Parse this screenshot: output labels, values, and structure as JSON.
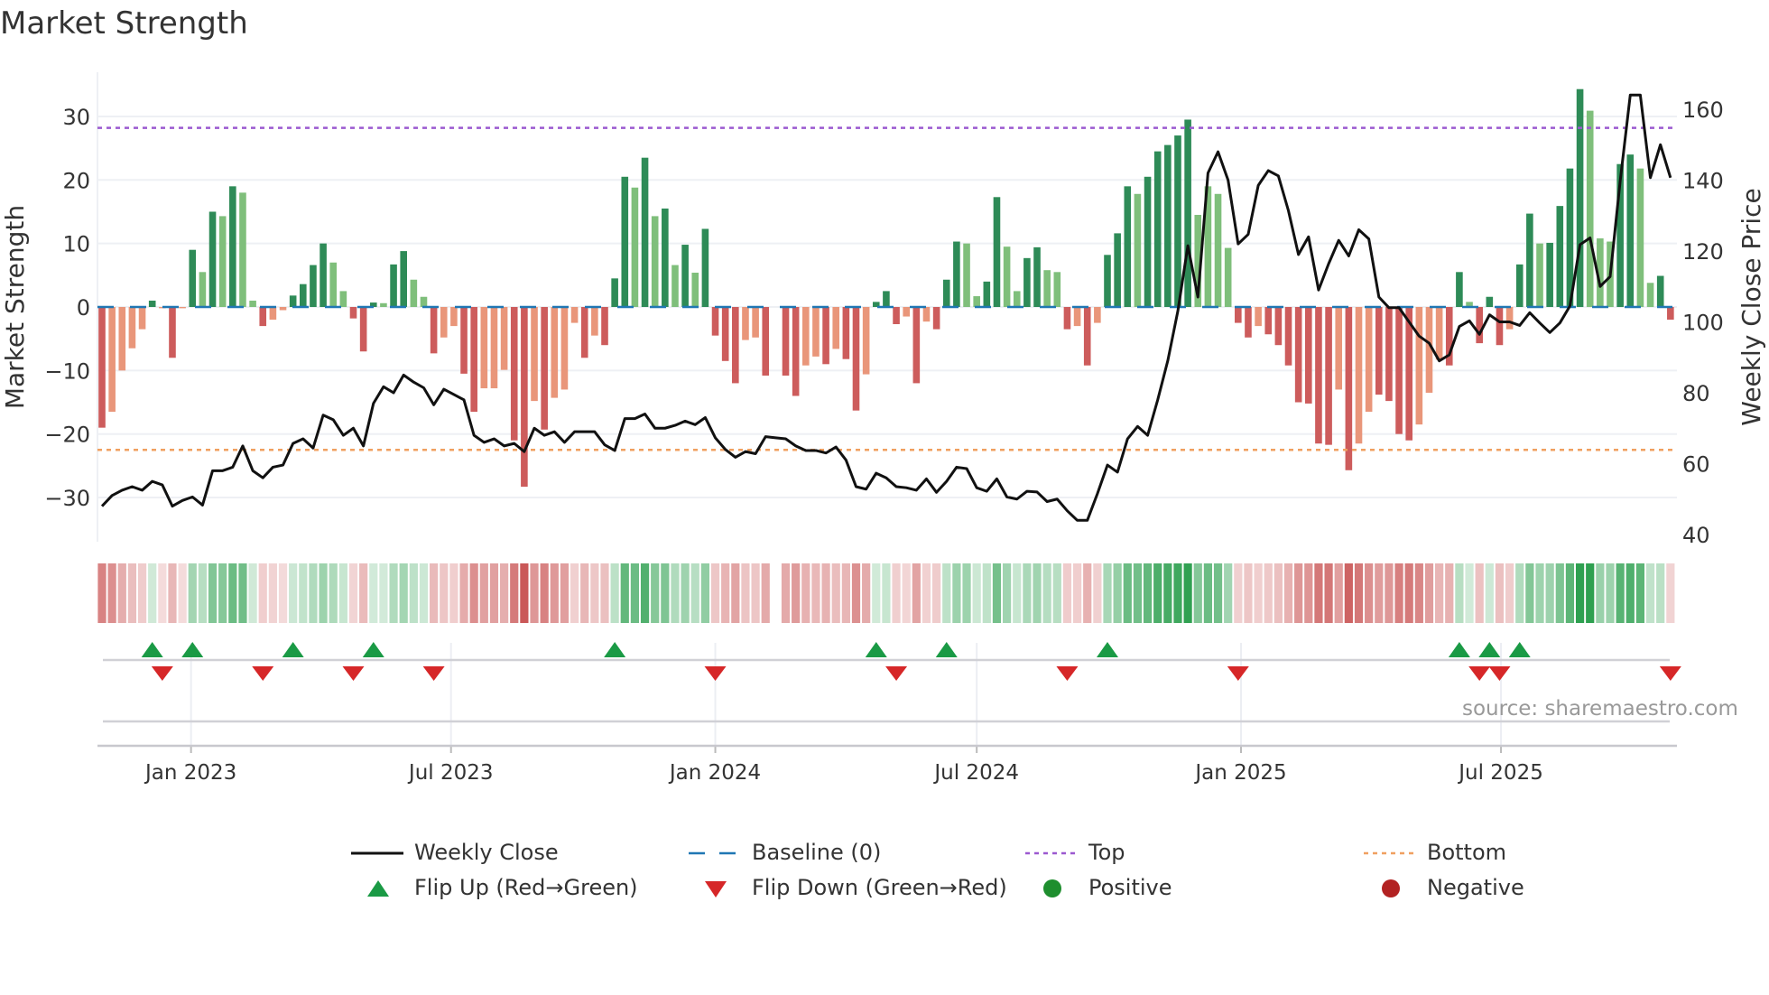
{
  "title": "Market Strength",
  "source": "source: sharemaestro.com",
  "chart_data": {
    "type": "bar",
    "title": "Market Strength",
    "x_start": "2022-10-31",
    "x_interval_days": 7,
    "ylabel": "Market Strength",
    "y2label": "Weekly Close Price",
    "ylim": [
      -35,
      37
    ],
    "y2lim": [
      38,
      172
    ],
    "yticks": [
      "−30",
      "−20",
      "−10",
      "0",
      "10",
      "20",
      "30"
    ],
    "ytick_values": [
      -30,
      -20,
      -10,
      0,
      10,
      20,
      30
    ],
    "y2ticks": [
      "40",
      "60",
      "80",
      "100",
      "120",
      "140",
      "160"
    ],
    "y2tick_values": [
      40,
      60,
      80,
      100,
      120,
      140,
      160
    ],
    "xticks": [
      {
        "label": "Jan 2023",
        "date": "2023-01-01"
      },
      {
        "label": "Jul 2023",
        "date": "2023-07-01"
      },
      {
        "label": "Jan 2024",
        "date": "2024-01-01"
      },
      {
        "label": "Jul 2024",
        "date": "2024-07-01"
      },
      {
        "label": "Jan 2025",
        "date": "2025-01-01"
      },
      {
        "label": "Jul 2025",
        "date": "2025-07-01"
      }
    ],
    "top_level": 28.2,
    "bottom_level": -22.5,
    "baseline": 0,
    "strength": [
      -19,
      -16.5,
      -10,
      -6.5,
      -3.5,
      1,
      -0.2,
      -8,
      -0.2,
      9,
      5.5,
      15,
      14.3,
      19,
      18,
      1,
      -3,
      -2,
      -0.5,
      1.8,
      3.6,
      6.6,
      10,
      7,
      2.5,
      -1.8,
      -7,
      0.7,
      0.6,
      6.7,
      8.8,
      4.3,
      1.6,
      -7.3,
      -4.8,
      -3,
      -10.5,
      -16.5,
      -12.8,
      -12.8,
      -9.9,
      -21,
      -28.3,
      -14.8,
      -19.3,
      -14.3,
      -13,
      -2.5,
      -8,
      -4.5,
      -6,
      4.5,
      20.5,
      18.8,
      23.5,
      14.3,
      15.5,
      6.6,
      9.8,
      5.4,
      12.3,
      -4.5,
      -8.5,
      -12,
      -5.2,
      -4.8,
      -10.8,
      null,
      -10.8,
      -14,
      -9.2,
      -7.8,
      -9,
      -6.6,
      -8.2,
      -16.3,
      -10.6,
      0.8,
      2.5,
      -2.7,
      -1.5,
      -12,
      -2.3,
      -3.5,
      4.3,
      10.3,
      10,
      1.7,
      4,
      17.3,
      9.5,
      2.5,
      7.7,
      9.4,
      5.8,
      5.5,
      -3.5,
      -3,
      -9.2,
      -2.5,
      8.2,
      11.6,
      19,
      17.8,
      20.5,
      24.5,
      25.5,
      27,
      29.5,
      14.5,
      19,
      17.8,
      9.3,
      -2.5,
      -4.8,
      -3,
      -4.3,
      -6,
      -9.2,
      -15,
      -15.2,
      -21.5,
      -21.7,
      -13,
      -25.7,
      -21.5,
      -16.5,
      -13.8,
      -14.8,
      -20,
      -21,
      -18.5,
      -13.5,
      -8.3,
      -9.2,
      5.5,
      0.8,
      -5.7,
      1.6,
      -6,
      -3.5,
      6.7,
      14.7,
      10,
      10.1,
      15.9,
      21.8,
      34.3,
      30.9,
      10.8,
      10.3,
      22.5,
      24,
      21.8,
      3.8,
      4.9,
      -2
    ],
    "tone": "DLLLLDLDLDLDLDLLDLLDDDDLLDDDLDDLLDLLDDLLLDDLDLLLDLDDDLDLDLDLDDDDLLDLDDLLDLDDLDDDLDLDDDLLDDLLDDLLDLDLDDDLDDDDDLLLLDDLDDDDDDDLDLLDDDDLLLDDLDDDLDDLDDDDLLLDDLLDD",
    "weekly_close": [
      48,
      51,
      52.5,
      53.5,
      52.5,
      55,
      54,
      48,
      49.6,
      50.6,
      48.3,
      58,
      58,
      59,
      65,
      58,
      56,
      59,
      59.6,
      65.7,
      67,
      64.4,
      73.7,
      72.4,
      68,
      70,
      65,
      77,
      81.7,
      80,
      85,
      83,
      81.4,
      76.6,
      81,
      79.5,
      78,
      68,
      66,
      67,
      65,
      65.7,
      63.4,
      70,
      68,
      69,
      66,
      69,
      69,
      69,
      65.3,
      63.7,
      72.7,
      72.7,
      74,
      70,
      70,
      70.8,
      72,
      71,
      73,
      67.3,
      64,
      61.8,
      63.4,
      62.8,
      67.6,
      67.3,
      67,
      65,
      63.7,
      63.7,
      63,
      64.7,
      61,
      53.5,
      52.8,
      57.3,
      56,
      53.5,
      53.2,
      52.5,
      55.7,
      51.9,
      55,
      59,
      58.6,
      53.2,
      52.2,
      55.7,
      50.6,
      50,
      52.2,
      52,
      49.3,
      50,
      46.7,
      44,
      44,
      51.5,
      59.6,
      57.6,
      67,
      70.5,
      68,
      78,
      89,
      103,
      121.5,
      107,
      142,
      148,
      140,
      122,
      124.7,
      138.5,
      142.7,
      141.2,
      131.4,
      119,
      124,
      109,
      116.4,
      123,
      118.6,
      126,
      123.4,
      107,
      104,
      104,
      100,
      96,
      94,
      89,
      90.7,
      98.7,
      100.3,
      96.5,
      102,
      100,
      100,
      99,
      102.6,
      99.7,
      97,
      99.7,
      104.5,
      121.8,
      123.7,
      110,
      112.8,
      139.8,
      164,
      164,
      140.7,
      150,
      140.7
    ],
    "flip_up_weeks": [
      5,
      9,
      19,
      27,
      51,
      77,
      84,
      100,
      135,
      138,
      141
    ],
    "flip_down_weeks": [
      6,
      16,
      25,
      33,
      61,
      79,
      96,
      113,
      137,
      139,
      156
    ],
    "colors": {
      "positive_strong": "#2e8b57",
      "positive_weak": "#7fbf7b",
      "negative_strong": "#cd5c5c",
      "negative_weak": "#e9967a",
      "close": "#111111",
      "baseline": "#1f77b4",
      "top": "#9b59d0",
      "bottom": "#f0a060",
      "flip_up": "#1a9a45",
      "flip_down": "#d62728",
      "positive": "#1e8e2e",
      "negative": "#b22222"
    },
    "legend": [
      {
        "key": "close",
        "label": "Weekly Close"
      },
      {
        "key": "baseline",
        "label": "Baseline (0)"
      },
      {
        "key": "top",
        "label": "Top"
      },
      {
        "key": "bottom",
        "label": "Bottom"
      },
      {
        "key": "flip_up",
        "label": "Flip Up (Red→Green)"
      },
      {
        "key": "flip_down",
        "label": "Flip Down (Green→Red)"
      },
      {
        "key": "positive",
        "label": "Positive"
      },
      {
        "key": "negative",
        "label": "Negative"
      }
    ]
  }
}
